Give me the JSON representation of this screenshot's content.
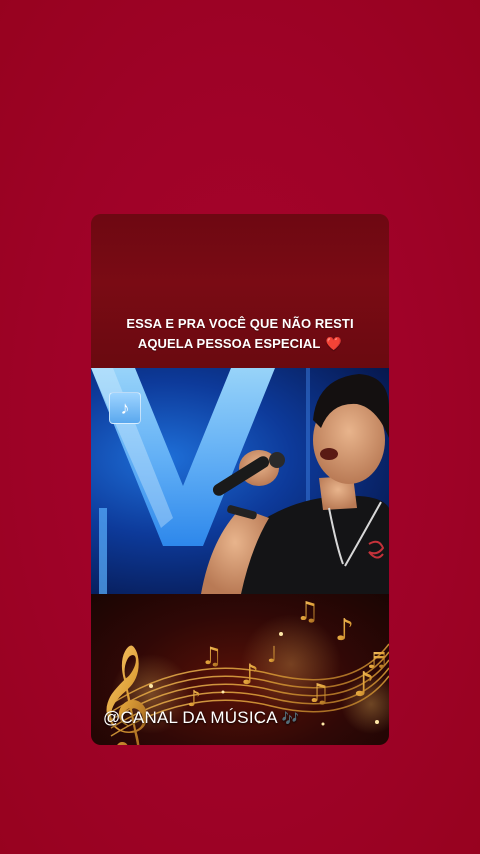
{
  "caption": {
    "line1": "ESSA E PRA VOCÊ QUE NÃO RESTI",
    "line2": "AQUELA PESSOA ESPECIAL",
    "heart_emoji": "❤️"
  },
  "video": {
    "badge_icon": "music-note-icon"
  },
  "footer": {
    "channel_handle": "@CANAL DA MÚSICA",
    "channel_icon": "🎶"
  },
  "colors": {
    "background": "#a10229",
    "caption_bg": "#7a0b14",
    "stage_blue": "#1e6fd8",
    "gold": "#e0a23a"
  }
}
